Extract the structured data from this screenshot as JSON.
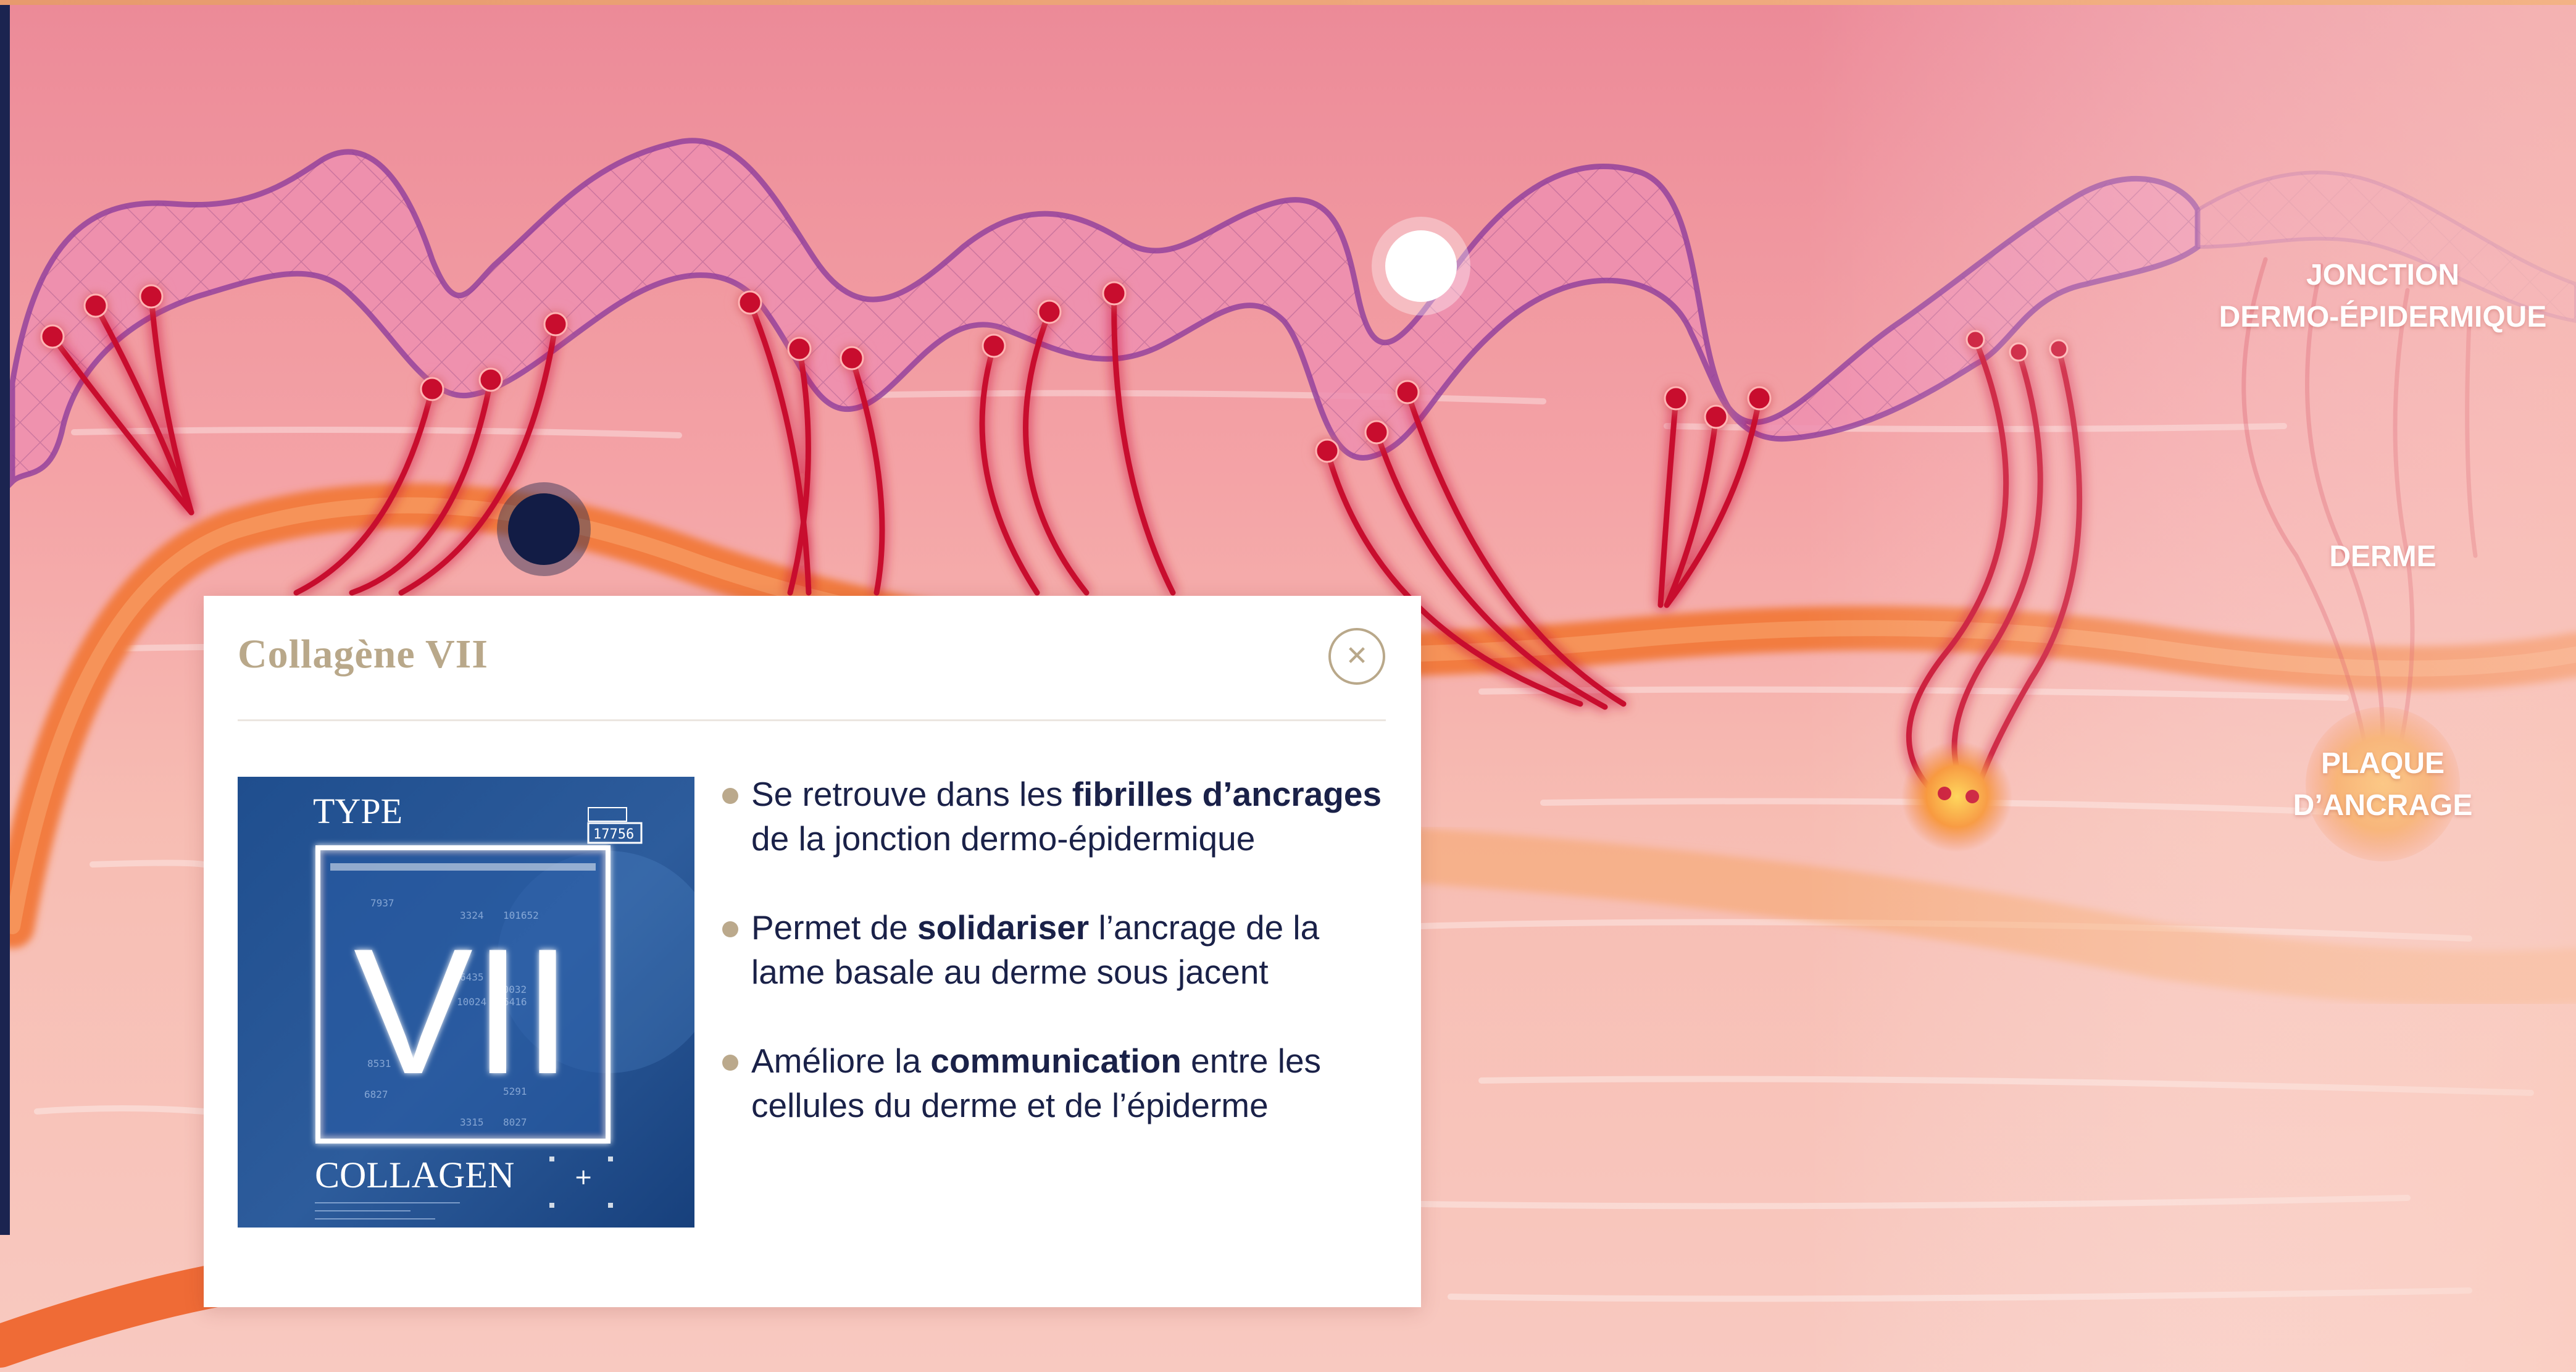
{
  "labels": {
    "jonction_line1": "JONCTION",
    "jonction_line2": "DERMO-ÉPIDERMIQUE",
    "derme": "DERME",
    "plaque_line1": "PLAQUE",
    "plaque_line2": "D’ANCRAGE"
  },
  "popup": {
    "title": "Collagène VII",
    "close_symbol": "✕",
    "card": {
      "type_label": "TYPE",
      "numeral": "VII",
      "collagen_label": "COLLAGEN",
      "badge_number": "17756",
      "grid_numbers": [
        "3324",
        "101652",
        "6435",
        "10032",
        "10024",
        "6416",
        "8531",
        "6827",
        "5291",
        "3315",
        "8027",
        "7937"
      ]
    },
    "bullets": [
      {
        "before": "Se retrouve dans les ",
        "bold": "fibrilles d’ancrages",
        "after": " de la jonction dermo-épidermique"
      },
      {
        "before": "Permet de ",
        "bold": "solidariser",
        "after": " l’ancrage de la lame basale au derme sous jacent"
      },
      {
        "before": "Améliore la ",
        "bold": "communication",
        "after": " entre les cellules du derme et de l’épiderme"
      }
    ]
  },
  "hotspots": [
    {
      "name": "hotspot-white",
      "state": "default"
    },
    {
      "name": "hotspot-navy",
      "state": "active"
    }
  ],
  "colors": {
    "accent_gold": "#b9a88a",
    "navy": "#1a2148",
    "fibril_red": "#c8102e",
    "membrane_purple": "#9b4fa6",
    "vessel_orange": "#f07a3a"
  }
}
